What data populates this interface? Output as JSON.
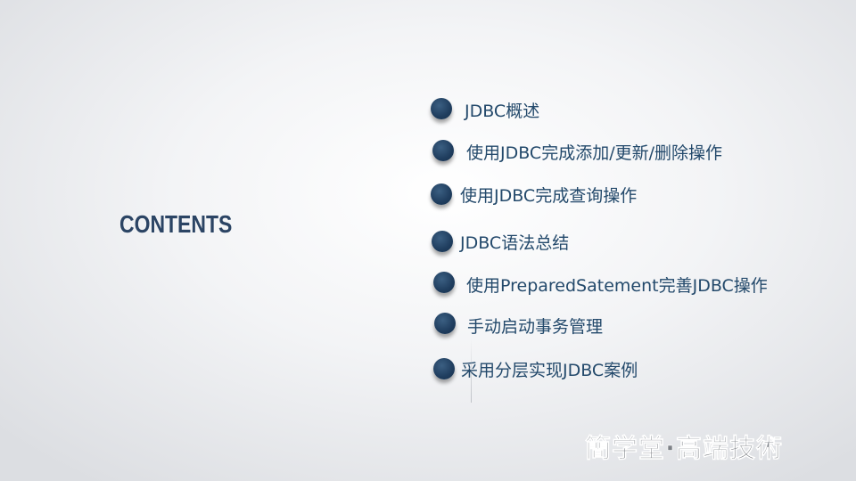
{
  "slide": {
    "title": "CONTENTS",
    "items": [
      {
        "label": "JDBC概述"
      },
      {
        "label": "使用JDBC完成添加/更新/删除操作"
      },
      {
        "label": "使用JDBC完成查询操作"
      },
      {
        "label": "JDBC语法总结"
      },
      {
        "label": "使用PreparedSatement完善JDBC操作"
      },
      {
        "label": "手动启动事务管理"
      },
      {
        "label": "采用分层实现JDBC案例"
      }
    ],
    "watermark": {
      "text": "簡学堂·高端技術"
    }
  },
  "colors": {
    "title": "#2b4464",
    "dot": "#1f3d5e",
    "label": "#23496b"
  }
}
